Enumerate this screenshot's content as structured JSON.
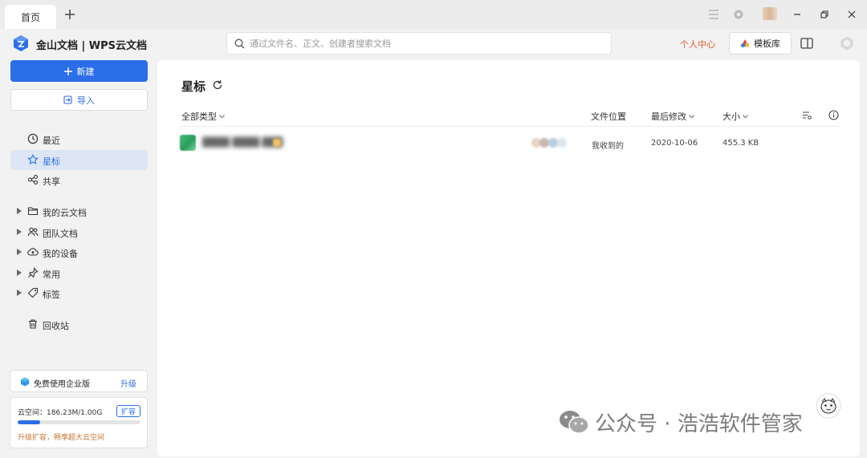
{
  "titlebar": {
    "tab_label": "首页",
    "add_tab": "+"
  },
  "header": {
    "brand": "金山文档 | WPS云文档",
    "search_placeholder": "通过文件名、正文、创建者搜索文档",
    "personal_center": "个人中心",
    "template_label": "模板库"
  },
  "sidebar": {
    "new_label": "新建",
    "import_label": "导入",
    "nav": [
      {
        "label": "最近",
        "icon": "clock-icon",
        "expandable": false,
        "active": false
      },
      {
        "label": "星标",
        "icon": "star-icon",
        "expandable": false,
        "active": true
      },
      {
        "label": "共享",
        "icon": "share-icon",
        "expandable": false,
        "active": false
      },
      {
        "label": "我的云文档",
        "icon": "folder-icon",
        "expandable": true,
        "active": false
      },
      {
        "label": "团队文档",
        "icon": "team-icon",
        "expandable": true,
        "active": false
      },
      {
        "label": "我的设备",
        "icon": "cloud-icon",
        "expandable": true,
        "active": false
      },
      {
        "label": "常用",
        "icon": "pin-icon",
        "expandable": true,
        "active": false
      },
      {
        "label": "标签",
        "icon": "tag-icon",
        "expandable": true,
        "active": false
      },
      {
        "label": "回收站",
        "icon": "trash-icon",
        "expandable": false,
        "active": false
      }
    ],
    "enterprise_label": "免费使用企业版",
    "upgrade_label": "升级",
    "storage": {
      "label": "云空间：186.23M/1.00G",
      "expand_label": "扩容",
      "used_fraction": 0.182,
      "promo": "升级扩容，畅享超大云空间"
    }
  },
  "main": {
    "title": "星标",
    "columns": {
      "type_filter": "全部类型",
      "location": "文件位置",
      "modified": "最后修改",
      "size": "大小"
    },
    "files": [
      {
        "location": "我收到的",
        "modified": "2020-10-06",
        "size": "455.3 KB"
      }
    ]
  },
  "watermark": {
    "text": "公众号 · 浩浩软件管家"
  },
  "colors": {
    "accent": "#2b6ee8",
    "personal_center": "#e05a2b",
    "promo": "#c8742f",
    "active_nav_bg": "#dde6f5"
  }
}
